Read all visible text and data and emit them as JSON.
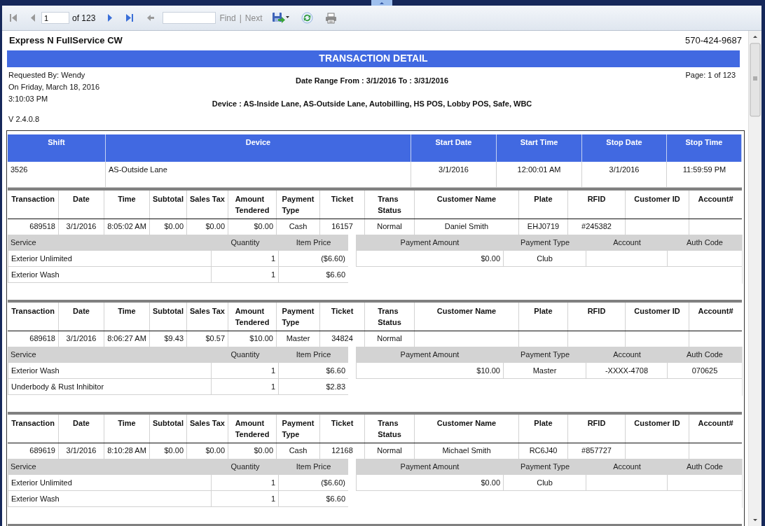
{
  "toolbar": {
    "items": [
      {
        "kind": "first",
        "disabled": true
      },
      {
        "kind": "previous",
        "disabled": true
      },
      {
        "kind": "page_input",
        "value": "1"
      },
      {
        "kind": "label",
        "text": "of 123"
      },
      {
        "kind": "next",
        "disabled": false
      },
      {
        "kind": "last",
        "disabled": false
      },
      {
        "kind": "back",
        "disabled": true
      },
      {
        "kind": "find_input"
      },
      {
        "kind": "link",
        "text": "Find",
        "disabled": true
      },
      {
        "kind": "separator",
        "text": "|"
      },
      {
        "kind": "link",
        "text": "Next",
        "disabled": true
      },
      {
        "kind": "export"
      },
      {
        "kind": "refresh"
      },
      {
        "kind": "print"
      }
    ]
  },
  "report": {
    "company": "Express N FullService CW",
    "phone": "570-424-9687",
    "title": "TRANSACTION DETAIL",
    "requested_by": "Requested By: Wendy",
    "requested_on": "On Friday, March 18, 2016",
    "requested_time": "3:10:03 PM",
    "version": "V 2.4.0.8",
    "date_range": "Date Range From : 3/1/2016 To : 3/31/2016",
    "devices": "Device : AS-Inside Lane, AS-Outside Lane, Autobilling, HS POS, Lobby POS, Safe, WBC",
    "page": "Page: 1 of 123"
  },
  "shift_table": {
    "columns": [
      "Shift",
      "Device",
      "Start Date",
      "Start Time",
      "Stop Date",
      "Stop Time"
    ],
    "rows": [
      [
        "3526",
        "AS-Outside Lane",
        "3/1/2016",
        "12:00:01 AM",
        "3/1/2016",
        "11:59:59 PM"
      ]
    ]
  },
  "transactions": [
    {
      "columns": [
        "Transaction",
        "Date",
        "Time",
        "Subtotal",
        "Sales Tax",
        "Amount Tendered",
        "Payment Type",
        "Ticket",
        "Trans Status",
        "Customer Name",
        "Plate",
        "RFID",
        "Customer ID",
        "Account#"
      ],
      "values": {
        "transaction": "689518",
        "date": "3/1/2016",
        "time": "8:05:02 AM",
        "subtotal": "$0.00",
        "sales_tax": "$0.00",
        "amount_tendered": "$0.00",
        "payment_type": "Cash",
        "ticket": "16157",
        "trans_status": "Normal",
        "customer_name": "Daniel Smith",
        "plate": "EHJ0719",
        "rfid": "#245382"
      },
      "services": {
        "columns": [
          "Service",
          "Quantity",
          "Item Price"
        ],
        "rows": [
          [
            "Exterior Unlimited",
            "1",
            "($6.60)"
          ],
          [
            "Exterior Wash",
            "1",
            "$6.60"
          ]
        ]
      },
      "payments": {
        "columns": [
          "Payment Amount",
          "Payment Type",
          "Account",
          "Auth Code"
        ],
        "rows": [
          {
            "payment_amount": "$0.00",
            "payment_type": "Club"
          }
        ]
      }
    },
    {
      "columns": [
        "Transaction",
        "Date",
        "Time",
        "Subtotal",
        "Sales Tax",
        "Amount Tendered",
        "Payment Type",
        "Ticket",
        "Trans Status",
        "Customer Name",
        "Plate",
        "RFID",
        "Customer ID",
        "Account#"
      ],
      "values": {
        "transaction": "689618",
        "date": "3/1/2016",
        "time": "8:06:27 AM",
        "subtotal": "$9.43",
        "sales_tax": "$0.57",
        "amount_tendered": "$10.00",
        "payment_type": "Master",
        "ticket": "34824",
        "trans_status": "Normal"
      },
      "services": {
        "columns": [
          "Service",
          "Quantity",
          "Item Price"
        ],
        "rows": [
          [
            "Exterior Wash",
            "1",
            "$6.60"
          ],
          [
            "Underbody & Rust Inhibitor",
            "1",
            "$2.83"
          ]
        ]
      },
      "payments": {
        "columns": [
          "Payment Amount",
          "Payment Type",
          "Account",
          "Auth Code"
        ],
        "rows": [
          {
            "payment_amount": "$10.00",
            "payment_type": "Master",
            "account": "-XXXX-4708",
            "auth_code": "070625"
          }
        ]
      }
    },
    {
      "columns": [
        "Transaction",
        "Date",
        "Time",
        "Subtotal",
        "Sales Tax",
        "Amount Tendered",
        "Payment Type",
        "Ticket",
        "Trans Status",
        "Customer Name",
        "Plate",
        "RFID",
        "Customer ID",
        "Account#"
      ],
      "values": {
        "transaction": "689619",
        "date": "3/1/2016",
        "time": "8:10:28 AM",
        "subtotal": "$0.00",
        "sales_tax": "$0.00",
        "amount_tendered": "$0.00",
        "payment_type": "Cash",
        "ticket": "12168",
        "trans_status": "Normal",
        "customer_name": "Michael  Smith",
        "plate": "RC6J40",
        "rfid": "#857727"
      },
      "services": {
        "columns": [
          "Service",
          "Quantity",
          "Item Price"
        ],
        "rows": [
          [
            "Exterior Unlimited",
            "1",
            "($6.60)"
          ],
          [
            "Exterior Wash",
            "1",
            "$6.60"
          ]
        ]
      },
      "payments": {
        "columns": [
          "Payment Amount",
          "Payment Type",
          "Account",
          "Auth Code"
        ],
        "rows": [
          {
            "payment_amount": "$0.00",
            "payment_type": "Club"
          }
        ]
      }
    }
  ]
}
